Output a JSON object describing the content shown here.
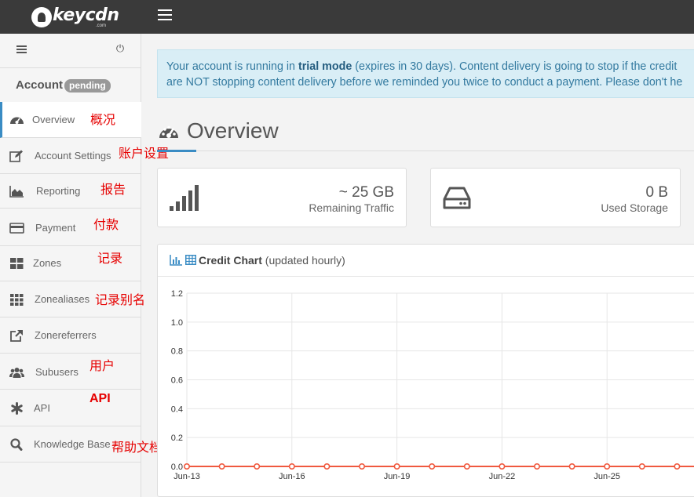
{
  "brand": {
    "logo_text": "keycdn",
    "logo_sub": ".com"
  },
  "sidebar": {
    "account_label": "Account",
    "account_badge": "pending",
    "items": [
      {
        "label": "Overview",
        "note": "概况",
        "icon": "dashboard-icon",
        "active": true
      },
      {
        "label": "Account Settings",
        "note": "账户设置",
        "icon": "edit-icon"
      },
      {
        "label": "Reporting",
        "note": "报告",
        "icon": "area-chart-icon"
      },
      {
        "label": "Payment",
        "note": "付款",
        "icon": "credit-card-icon"
      },
      {
        "label": "Zones",
        "note": "记录",
        "icon": "grid-large-icon"
      },
      {
        "label": "Zonealiases",
        "note": "记录别名",
        "icon": "grid-small-icon"
      },
      {
        "label": "Zonereferrers",
        "note": "",
        "icon": "external-link-icon"
      },
      {
        "label": "Subusers",
        "note": "用户",
        "icon": "users-icon"
      },
      {
        "label": "API",
        "note": "API",
        "icon": "asterisk-icon"
      },
      {
        "label": "Knowledge Base",
        "note": "帮助文档",
        "icon": "search-icon"
      }
    ]
  },
  "alert": {
    "line1_prefix": "Your account is running in ",
    "line1_bold": "trial mode",
    "line1_suffix": " (expires in 30 days). Content delivery is going to stop if the credit",
    "line2": "are NOT stopping content delivery before we reminded you twice to conduct a payment. Please don't he"
  },
  "page_title": "Overview",
  "stats": {
    "traffic": {
      "value": "~ 25 GB",
      "label": "Remaining Traffic",
      "icon": "signal-bars-icon"
    },
    "storage": {
      "value": "0 B",
      "label": "Used Storage",
      "icon": "hard-drive-icon"
    }
  },
  "credit_chart": {
    "title": "Credit Chart",
    "subtitle": "(updated hourly)",
    "icons": [
      "bar-chart-icon",
      "table-icon"
    ]
  },
  "colors": {
    "accent": "#3a8cc4",
    "series": "#f0593f",
    "topbar": "#3a3a3a",
    "note": "#e60000"
  },
  "chart_data": {
    "type": "line",
    "title": "",
    "xlabel": "",
    "ylabel": "",
    "ylim": [
      0,
      1.2
    ],
    "y_ticks": [
      "0.0",
      "0.2",
      "0.4",
      "0.6",
      "0.8",
      "1.0",
      "1.2"
    ],
    "x_tick_labels": [
      "Jun-13",
      "Jun-16",
      "Jun-19",
      "Jun-22",
      "Jun-25"
    ],
    "x": [
      "Jun-13",
      "Jun-14",
      "Jun-15",
      "Jun-16",
      "Jun-17",
      "Jun-18",
      "Jun-19",
      "Jun-20",
      "Jun-21",
      "Jun-22",
      "Jun-23",
      "Jun-24",
      "Jun-25",
      "Jun-26",
      "Jun-27"
    ],
    "series": [
      {
        "values": [
          0,
          0,
          0,
          0,
          0,
          0,
          0,
          0,
          0,
          0,
          0,
          0,
          0,
          0,
          0
        ]
      }
    ],
    "grid": true,
    "legend": "none"
  }
}
